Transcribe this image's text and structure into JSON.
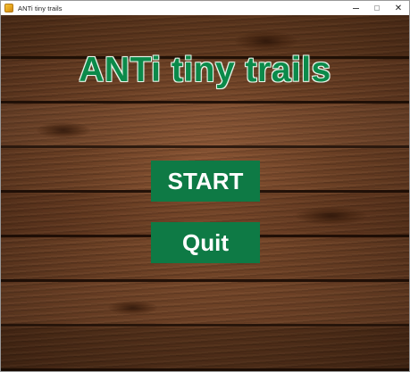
{
  "window": {
    "title": "ANTi tiny trails",
    "controls": {
      "minimize": "minimize-icon",
      "maximize": "maximize-icon",
      "close": "close-icon",
      "close_glyph": "✕"
    }
  },
  "game": {
    "title": "ANTi tiny trails",
    "title_color": "#0b8a4a",
    "button_color": "#0e7a45",
    "background": "wooden planks",
    "buttons": {
      "start_label": "START",
      "quit_label": "Quit"
    }
  }
}
